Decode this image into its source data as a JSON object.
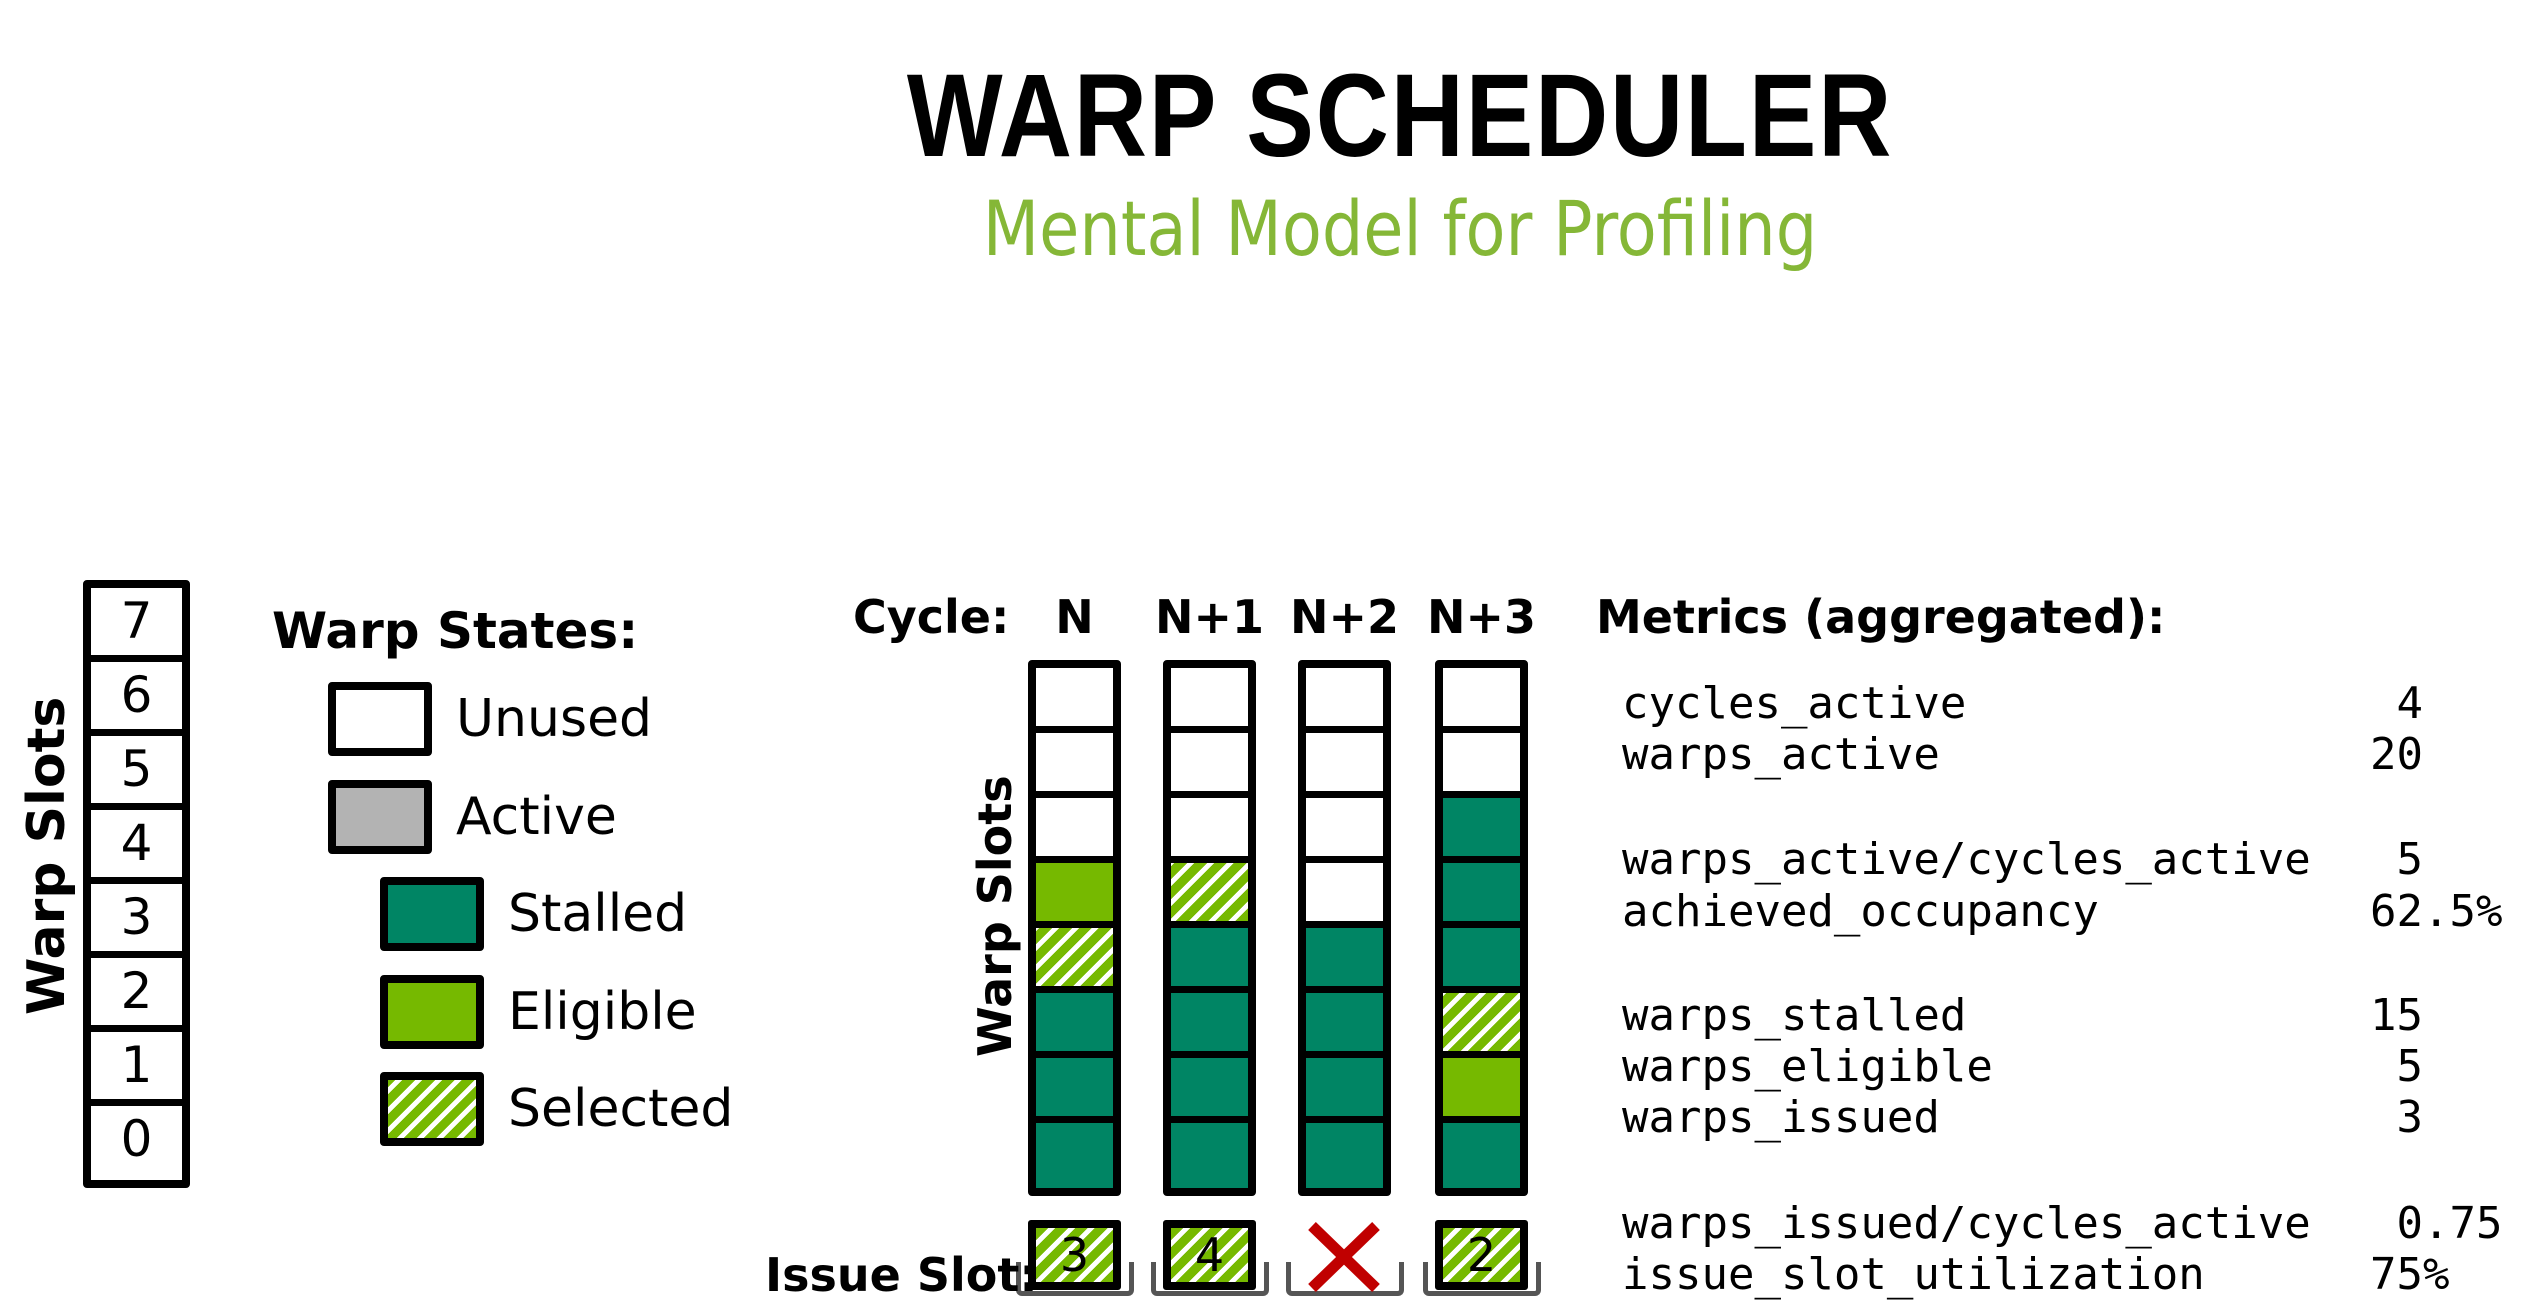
{
  "title": "WARP SCHEDULER",
  "subtitle": "Mental Model for Profiling",
  "colors": {
    "unused": "#ffffff",
    "active": "#b3b3b3",
    "stalled": "#008564",
    "eligible": "#76b900",
    "selected_hatch": "#76b900",
    "subtitle": "#85b737",
    "issue_none": "#c00000"
  },
  "warp_slots": {
    "axis_label": "Warp Slots",
    "slots": [
      "7",
      "6",
      "5",
      "4",
      "3",
      "2",
      "1",
      "0"
    ]
  },
  "legend": {
    "title": "Warp States:",
    "items": [
      {
        "label": "Unused",
        "state": "unused",
        "level": 0
      },
      {
        "label": "Active",
        "state": "active",
        "level": 0
      },
      {
        "label": "Stalled",
        "state": "stalled",
        "level": 1
      },
      {
        "label": "Eligible",
        "state": "eligible",
        "level": 1
      },
      {
        "label": "Selected",
        "state": "selected",
        "level": 1
      }
    ]
  },
  "cycles": {
    "label": "Cycle:",
    "axis_label": "Warp Slots",
    "issue_label": "Issue Slot:",
    "columns": [
      {
        "name": "N",
        "slots_top_to_bottom": [
          "unused",
          "unused",
          "unused",
          "eligible",
          "selected",
          "stalled",
          "stalled",
          "stalled"
        ],
        "issued": "3"
      },
      {
        "name": "N+1",
        "slots_top_to_bottom": [
          "unused",
          "unused",
          "unused",
          "selected",
          "stalled",
          "stalled",
          "stalled",
          "stalled"
        ],
        "issued": "4"
      },
      {
        "name": "N+2",
        "slots_top_to_bottom": [
          "unused",
          "unused",
          "unused",
          "unused",
          "stalled",
          "stalled",
          "stalled",
          "stalled"
        ],
        "issued": null
      },
      {
        "name": "N+3",
        "slots_top_to_bottom": [
          "unused",
          "unused",
          "stalled",
          "stalled",
          "stalled",
          "selected",
          "eligible",
          "stalled"
        ],
        "issued": "2"
      }
    ]
  },
  "metrics": {
    "title": "Metrics (aggregated):",
    "groups": [
      [
        {
          "name": "cycles_active",
          "value": " 4"
        },
        {
          "name": "warps_active",
          "value": "20"
        }
      ],
      [
        {
          "name": "warps_active/cycles_active",
          "value": " 5"
        },
        {
          "name": "achieved_occupancy",
          "value": "62.5%"
        }
      ],
      [
        {
          "name": "warps_stalled",
          "value": "15"
        },
        {
          "name": "warps_eligible",
          "value": " 5"
        },
        {
          "name": "warps_issued",
          "value": " 3"
        }
      ],
      [
        {
          "name": "warps_issued/cycles_active",
          "value": " 0.75"
        },
        {
          "name": "issue_slot_utilization",
          "value": "75%"
        }
      ]
    ]
  }
}
